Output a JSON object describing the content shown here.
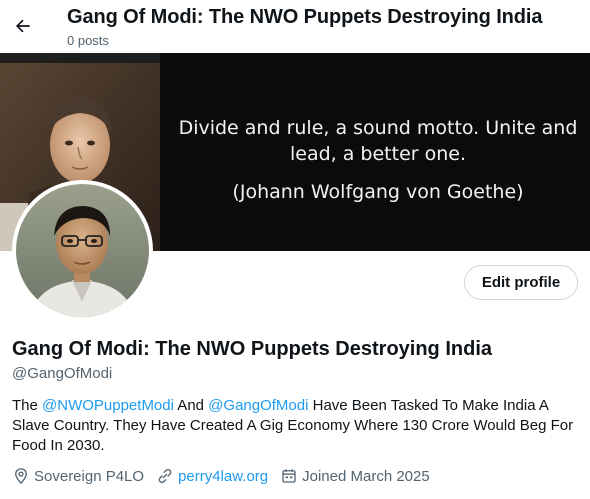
{
  "header": {
    "title": "Gang Of Modi: The NWO Puppets Destroying India",
    "posts": "0 posts"
  },
  "banner": {
    "quote_line1": "Divide and rule, a sound motto. Unite and lead, a better one.",
    "quote_line2": "(Johann Wolfgang von Goethe)"
  },
  "profile": {
    "edit_label": "Edit profile",
    "name": "Gang Of Modi: The NWO Puppets Destroying India",
    "handle": "@GangOfModi",
    "bio": {
      "t1": "The ",
      "m1": "@NWOPuppetModi",
      "t2": " And ",
      "m2": "@GangOfModi",
      "t3": " Have Been Tasked To Make India A Slave Country. They Have Created A Gig Economy Where 130 Crore Would Beg For Food In 2030."
    },
    "location": "Sovereign P4LO",
    "website": "perry4law.org",
    "joined": "Joined March 2025"
  },
  "colors": {
    "accent": "#1d9bf0",
    "secondary_text": "#536471",
    "banner_bg": "#0b0b0b"
  },
  "icons": [
    "back-arrow-icon",
    "location-pin-icon",
    "link-icon",
    "calendar-icon"
  ]
}
